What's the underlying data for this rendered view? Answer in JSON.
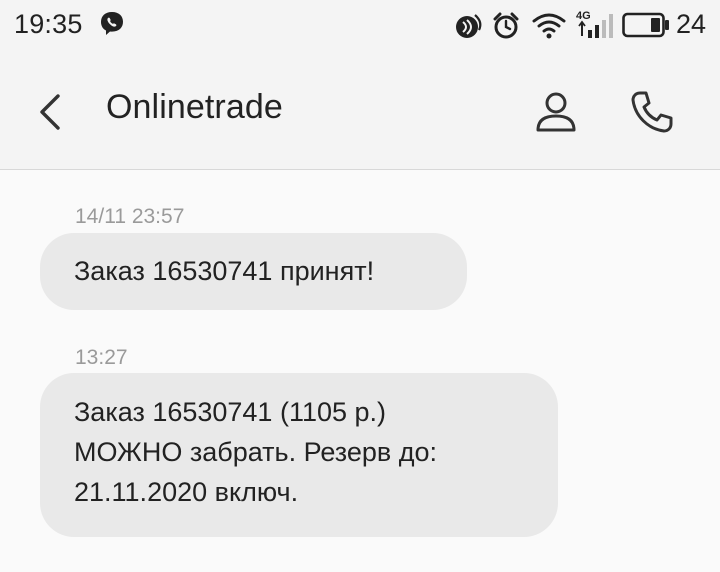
{
  "status_bar": {
    "time": "19:35",
    "battery_level": "24",
    "network_label": "4G",
    "icons": [
      "viber-icon",
      "nfc-icon",
      "alarm-icon",
      "wifi-icon",
      "signal-icon",
      "battery-icon"
    ]
  },
  "header": {
    "title": "Onlinetrade",
    "back_icon": "chevron-left-icon",
    "contact_icon": "person-icon",
    "call_icon": "phone-icon"
  },
  "messages": [
    {
      "time": "14/11 23:57",
      "text": "Заказ 16530741 принят!"
    },
    {
      "time": "13:27",
      "text": "Заказ 16530741 (1105 р.)\nМОЖНО забрать. Резерв до:\n21.11.2020 включ."
    }
  ],
  "colors": {
    "background": "#f4f4f4",
    "conversation_background": "#fafafa",
    "bubble": "#e9e9e9",
    "timestamp": "#9a9a9a",
    "text": "#222222"
  }
}
